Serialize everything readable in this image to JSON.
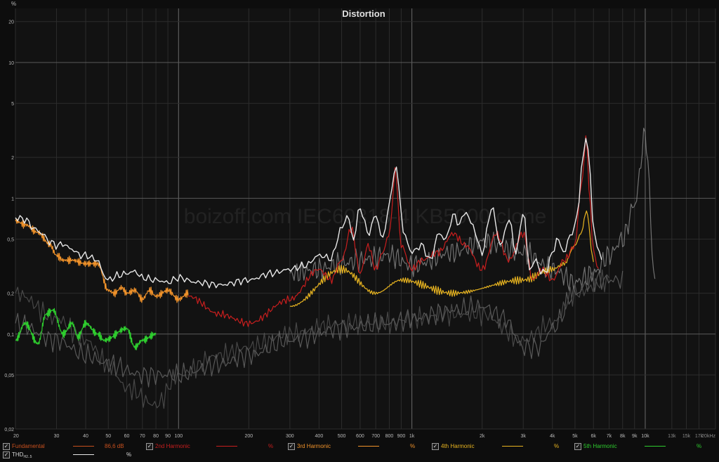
{
  "chart_data": {
    "type": "line",
    "title": "Distortion",
    "ylabel": "%",
    "xunit": "kHz",
    "x_scale": "log",
    "y_scale": "log",
    "xlim": [
      20,
      20000
    ],
    "ylim": [
      0.02,
      25
    ],
    "watermark": "boizoff.com IEC60318-4 KB5000 clone",
    "x_ticks": [
      {
        "v": 20,
        "l": "20"
      },
      {
        "v": 30,
        "l": "30"
      },
      {
        "v": 40,
        "l": "40"
      },
      {
        "v": 50,
        "l": "50"
      },
      {
        "v": 60,
        "l": "60"
      },
      {
        "v": 70,
        "l": "70"
      },
      {
        "v": 80,
        "l": "80"
      },
      {
        "v": 90,
        "l": "90"
      },
      {
        "v": 100,
        "l": "100"
      },
      {
        "v": 200,
        "l": "200"
      },
      {
        "v": 300,
        "l": "300"
      },
      {
        "v": 400,
        "l": "400"
      },
      {
        "v": 500,
        "l": "500"
      },
      {
        "v": 600,
        "l": "600"
      },
      {
        "v": 700,
        "l": "700"
      },
      {
        "v": 800,
        "l": "800"
      },
      {
        "v": 900,
        "l": "900"
      },
      {
        "v": 1000,
        "l": "1k"
      },
      {
        "v": 2000,
        "l": "2k"
      },
      {
        "v": 3000,
        "l": "3k"
      },
      {
        "v": 4000,
        "l": "4k"
      },
      {
        "v": 5000,
        "l": "5k"
      },
      {
        "v": 6000,
        "l": "6k"
      },
      {
        "v": 7000,
        "l": "7k"
      },
      {
        "v": 8000,
        "l": "8k"
      },
      {
        "v": 9000,
        "l": "9k"
      },
      {
        "v": 10000,
        "l": "10k"
      },
      {
        "v": 13000,
        "l": "13k"
      },
      {
        "v": 15000,
        "l": "15k"
      },
      {
        "v": 17000,
        "l": "17k"
      },
      {
        "v": 20000,
        "l": "20kHz"
      }
    ],
    "y_ticks": [
      {
        "v": 20,
        "l": "20"
      },
      {
        "v": 10,
        "l": "10"
      },
      {
        "v": 5,
        "l": "5"
      },
      {
        "v": 2,
        "l": "2"
      },
      {
        "v": 1,
        "l": "1"
      },
      {
        "v": 0.5,
        "l": "0,5"
      },
      {
        "v": 0.2,
        "l": "0,2"
      },
      {
        "v": 0.1,
        "l": "0,1"
      },
      {
        "v": 0.05,
        "l": "0,05"
      },
      {
        "v": 0.02,
        "l": "0,02"
      }
    ],
    "series": [
      {
        "key": "thd_ref",
        "color": "#8a8a8a",
        "x": [
          300,
          400,
          500,
          600,
          800,
          1000,
          1500,
          2000,
          3000,
          4000,
          5000,
          6000,
          7000,
          8000,
          9000,
          10000,
          11000
        ],
        "y": [
          0.28,
          0.3,
          0.33,
          0.35,
          0.38,
          0.32,
          0.4,
          0.48,
          0.4,
          0.3,
          0.24,
          0.28,
          0.38,
          0.5,
          0.9,
          2.9,
          0.26
        ]
      },
      {
        "key": "h2_ref",
        "color": "#6a6a6a",
        "x": [
          20,
          30,
          40,
          50,
          70,
          100,
          150,
          200,
          300,
          500,
          800,
          1000,
          1500,
          2000,
          2500,
          3000,
          3500,
          4000,
          5000,
          6000,
          8000
        ],
        "y": [
          0.12,
          0.09,
          0.07,
          0.06,
          0.05,
          0.05,
          0.06,
          0.07,
          0.09,
          0.11,
          0.12,
          0.13,
          0.15,
          0.16,
          0.13,
          0.08,
          0.08,
          0.11,
          0.2,
          0.25,
          0.25
        ]
      },
      {
        "key": "h3_ref",
        "color": "#555555",
        "x": [
          20,
          30,
          40,
          50,
          60,
          80,
          100,
          150,
          200,
          300,
          500,
          800,
          1000,
          1500,
          2000,
          3000,
          4000,
          5000,
          7000
        ],
        "y": [
          0.2,
          0.13,
          0.09,
          0.06,
          0.04,
          0.03,
          0.05,
          0.07,
          0.08,
          0.1,
          0.12,
          0.12,
          0.13,
          0.14,
          0.14,
          0.09,
          0.12,
          0.2,
          0.25
        ]
      },
      {
        "key": "h5",
        "name": "5th Harmonic",
        "color": "#2ecc2e",
        "x": [
          20,
          22,
          25,
          27,
          29,
          32,
          35,
          37,
          40,
          45,
          48,
          60,
          65,
          70,
          80
        ],
        "y": [
          0.09,
          0.12,
          0.085,
          0.14,
          0.15,
          0.1,
          0.12,
          0.095,
          0.12,
          0.1,
          0.09,
          0.11,
          0.08,
          0.09,
          0.1
        ]
      },
      {
        "key": "h4",
        "name": "4th Harmonic",
        "color": "#e8b420",
        "x": [
          300,
          500,
          700,
          900,
          1500,
          3000,
          4000,
          4500,
          5000,
          5300,
          5600,
          6000
        ],
        "y": [
          0.16,
          0.3,
          0.2,
          0.25,
          0.2,
          0.25,
          0.3,
          0.33,
          0.45,
          0.55,
          0.8,
          0.35
        ]
      },
      {
        "key": "h3",
        "name": "3rd Harmonic",
        "color": "#f0922a",
        "x": [
          20,
          22,
          25,
          28,
          30,
          32,
          35,
          40,
          45,
          50,
          53,
          57,
          60,
          65,
          70,
          75,
          80,
          90,
          100,
          110
        ],
        "y": [
          0.68,
          0.64,
          0.56,
          0.46,
          0.38,
          0.35,
          0.35,
          0.33,
          0.33,
          0.21,
          0.2,
          0.22,
          0.2,
          0.21,
          0.18,
          0.21,
          0.19,
          0.21,
          0.18,
          0.2
        ]
      },
      {
        "key": "h2",
        "name": "2nd Harmonic",
        "color": "#c81e1e",
        "x": [
          110,
          150,
          200,
          300,
          400,
          450,
          500,
          550,
          600,
          650,
          700,
          750,
          800,
          850,
          900,
          1000,
          1100,
          1300,
          1500,
          1700,
          2000,
          2300,
          2600,
          3000,
          3300,
          3600,
          4000,
          4500,
          5000,
          5300,
          5600,
          5800,
          6000,
          6300
        ],
        "y": [
          0.19,
          0.14,
          0.12,
          0.18,
          0.3,
          0.25,
          0.35,
          0.6,
          0.28,
          0.45,
          0.3,
          0.4,
          0.55,
          1.6,
          0.45,
          0.3,
          0.35,
          0.4,
          0.55,
          0.45,
          0.3,
          0.55,
          0.35,
          0.55,
          0.25,
          0.3,
          0.25,
          0.35,
          0.45,
          1.2,
          2.8,
          0.9,
          0.4,
          0.3
        ]
      },
      {
        "key": "thd",
        "name": "THD",
        "color": "#e8e8e8",
        "x": [
          20,
          22,
          24,
          26,
          28,
          30,
          32,
          35,
          38,
          40,
          45,
          48,
          50,
          55,
          60,
          65,
          70,
          80,
          90,
          100,
          120,
          150,
          200,
          250,
          300,
          350,
          400,
          450,
          500,
          530,
          560,
          600,
          650,
          700,
          750,
          800,
          850,
          880,
          920,
          1000,
          1100,
          1200,
          1300,
          1400,
          1500,
          1600,
          1700,
          1800,
          2000,
          2200,
          2400,
          2600,
          2800,
          3000,
          3200,
          3400,
          3600,
          3800,
          4000,
          4200,
          4500,
          4800,
          5000,
          5200,
          5400,
          5600,
          5800,
          6000,
          6200,
          6500
        ],
        "y": [
          0.72,
          0.7,
          0.6,
          0.55,
          0.48,
          0.45,
          0.46,
          0.42,
          0.38,
          0.38,
          0.35,
          0.27,
          0.25,
          0.27,
          0.28,
          0.29,
          0.26,
          0.25,
          0.24,
          0.26,
          0.24,
          0.23,
          0.25,
          0.28,
          0.3,
          0.32,
          0.38,
          0.36,
          0.6,
          0.75,
          0.5,
          0.85,
          0.55,
          0.75,
          0.5,
          0.9,
          1.75,
          1.2,
          0.55,
          0.4,
          0.45,
          0.35,
          0.55,
          0.5,
          0.75,
          0.65,
          0.8,
          0.65,
          0.4,
          0.85,
          0.45,
          0.7,
          0.4,
          0.8,
          0.3,
          0.35,
          0.28,
          0.3,
          0.4,
          0.5,
          0.4,
          0.55,
          0.6,
          1.0,
          2.0,
          3.0,
          1.5,
          0.6,
          0.45,
          0.35
        ]
      }
    ]
  },
  "legend": [
    {
      "key": "fundamental",
      "name": "Fundamental",
      "value": "86,6 dB",
      "unit": "",
      "color": "#c8501e"
    },
    {
      "key": "h2",
      "name": "2nd Harmonic",
      "value": "",
      "unit": "%",
      "color": "#c81e1e"
    },
    {
      "key": "h3",
      "name": "3rd Harmonic",
      "value": "",
      "unit": "%",
      "color": "#f0922a"
    },
    {
      "key": "h4",
      "name": "4th Harmonic",
      "value": "",
      "unit": "%",
      "color": "#e8b420"
    },
    {
      "key": "h5",
      "name": "5th Harmonic",
      "value": "",
      "unit": "%",
      "color": "#2ecc2e"
    },
    {
      "key": "thd",
      "name": "THD",
      "sub": "H2..5",
      "value": "",
      "unit": "%",
      "color": "#e8e8e8"
    }
  ],
  "checkbox_mark": "✓"
}
